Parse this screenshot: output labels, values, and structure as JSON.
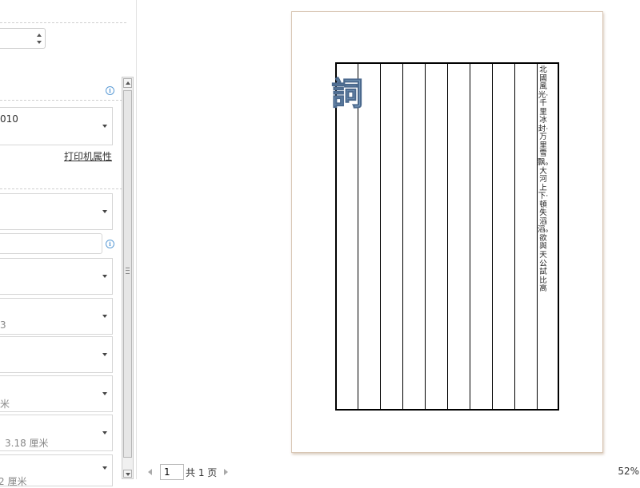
{
  "settings": {
    "copies": "",
    "printer_name": "010",
    "printer_properties": "打印机属性",
    "dropdown_rows": [
      {
        "value": "",
        "sub": ""
      },
      {
        "value": "",
        "sub": "3"
      },
      {
        "value": "",
        "sub": ""
      },
      {
        "value": "",
        "sub": "米"
      },
      {
        "value": "",
        "sub": "3.18 厘米"
      },
      {
        "value": "",
        "sub": "2 厘米"
      }
    ],
    "info_icon": "i"
  },
  "preview": {
    "title_glyph": "詞",
    "poem": "北國風光·千里冰封·万里雪飘。大河上下·頓失滔滔。欲與天公試比高",
    "grid_columns": 10
  },
  "footer": {
    "page_current": "1",
    "page_total_text": "共 1 页",
    "zoom": "52%"
  }
}
